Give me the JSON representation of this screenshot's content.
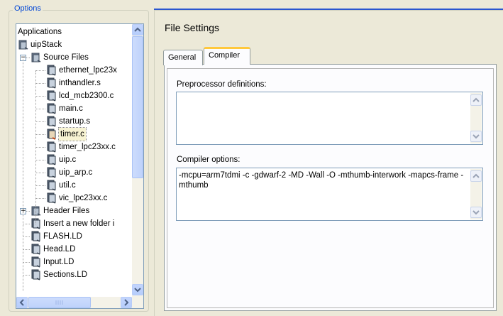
{
  "options": {
    "title": "Options"
  },
  "tree": [
    {
      "label": "Applications",
      "expander": ""
    },
    {
      "label": "uipStack",
      "expander": ""
    },
    {
      "label": "Source Files",
      "expander": "−"
    },
    {
      "label": "ethernet_lpc23x",
      "expander": ""
    },
    {
      "label": "inthandler.s",
      "expander": ""
    },
    {
      "label": "lcd_mcb2300.c",
      "expander": ""
    },
    {
      "label": "main.c",
      "expander": ""
    },
    {
      "label": "startup.s",
      "expander": ""
    },
    {
      "label": "timer.c",
      "expander": "",
      "selected": true
    },
    {
      "label": "timer_lpc23xx.c",
      "expander": ""
    },
    {
      "label": "uip.c",
      "expander": ""
    },
    {
      "label": "uip_arp.c",
      "expander": ""
    },
    {
      "label": "util.c",
      "expander": ""
    },
    {
      "label": "vic_lpc23xx.c",
      "expander": ""
    },
    {
      "label": "Header Files",
      "expander": "+"
    },
    {
      "label": "Insert a new folder i",
      "expander": ""
    },
    {
      "label": "FLASH.LD",
      "expander": ""
    },
    {
      "label": "Head.LD",
      "expander": ""
    },
    {
      "label": "Input.LD",
      "expander": ""
    },
    {
      "label": "Sections.LD",
      "expander": ""
    }
  ],
  "panel": {
    "title": "File Settings",
    "tabs": [
      "General",
      "Compiler"
    ],
    "active_tab": "Compiler",
    "preprocessor_label": "Preprocessor definitions:",
    "preprocessor_value": "",
    "compiler_label": "Compiler options:",
    "compiler_value": "-mcpu=arm7tdmi -c -gdwarf-2 -MD -Wall -O -mthumb-interwork -mapcs-frame -mthumb"
  },
  "icons": {
    "folder_icon": "project-folder-icon",
    "file_icon": "source-file-icon",
    "scroll_up": "scroll-up-arrow-icon",
    "scroll_down": "scroll-down-arrow-icon",
    "scroll_left": "scroll-left-arrow-icon",
    "scroll_right": "scroll-right-arrow-icon"
  },
  "colors": {
    "accent": "#2a56d0",
    "legend": "#0046d5",
    "tab_highlight": "#ffc83c",
    "selected": "#f7f3d3"
  }
}
